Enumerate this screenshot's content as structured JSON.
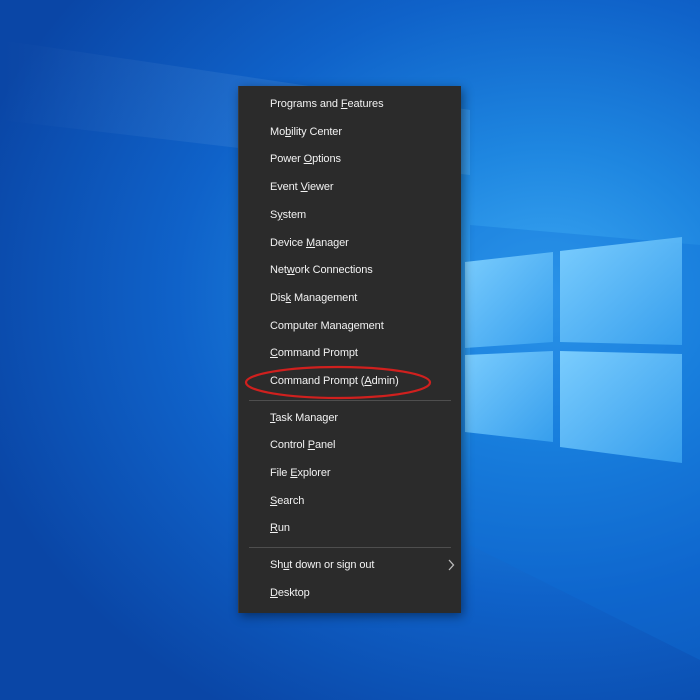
{
  "desktop": {
    "wallpaper": "windows-10-blue-logo"
  },
  "power_menu": {
    "groups": [
      [
        {
          "id": "programs-and-features",
          "label": "Programs and Features",
          "mnemonic": "F"
        },
        {
          "id": "mobility-center",
          "label": "Mobility Center",
          "mnemonic": "b"
        },
        {
          "id": "power-options",
          "label": "Power Options",
          "mnemonic": "O"
        },
        {
          "id": "event-viewer",
          "label": "Event Viewer",
          "mnemonic": "V"
        },
        {
          "id": "system",
          "label": "System",
          "mnemonic": "y"
        },
        {
          "id": "device-manager",
          "label": "Device Manager",
          "mnemonic": "M"
        },
        {
          "id": "network-connections",
          "label": "Network Connections",
          "mnemonic": "w"
        },
        {
          "id": "disk-management",
          "label": "Disk Management",
          "mnemonic": "k"
        },
        {
          "id": "computer-management",
          "label": "Computer Management",
          "mnemonic": ""
        },
        {
          "id": "command-prompt",
          "label": "Command Prompt",
          "mnemonic": "C"
        },
        {
          "id": "command-prompt-admin",
          "label": "Command Prompt (Admin)",
          "mnemonic": "A"
        }
      ],
      [
        {
          "id": "task-manager",
          "label": "Task Manager",
          "mnemonic": "T"
        },
        {
          "id": "control-panel",
          "label": "Control Panel",
          "mnemonic": "P"
        },
        {
          "id": "file-explorer",
          "label": "File Explorer",
          "mnemonic": "E"
        },
        {
          "id": "search",
          "label": "Search",
          "mnemonic": "S"
        },
        {
          "id": "run",
          "label": "Run",
          "mnemonic": "R"
        }
      ],
      [
        {
          "id": "shut-down-or-sign-out",
          "label": "Shut down or sign out",
          "mnemonic": "u",
          "submenu": true,
          "submenu_icon": "chevron-right-icon"
        },
        {
          "id": "desktop",
          "label": "Desktop",
          "mnemonic": "D"
        }
      ]
    ],
    "highlighted_item": "command-prompt-admin",
    "highlight_color": "#d0201e",
    "background_color": "#2b2b2b",
    "text_color": "#f2f2f2"
  }
}
